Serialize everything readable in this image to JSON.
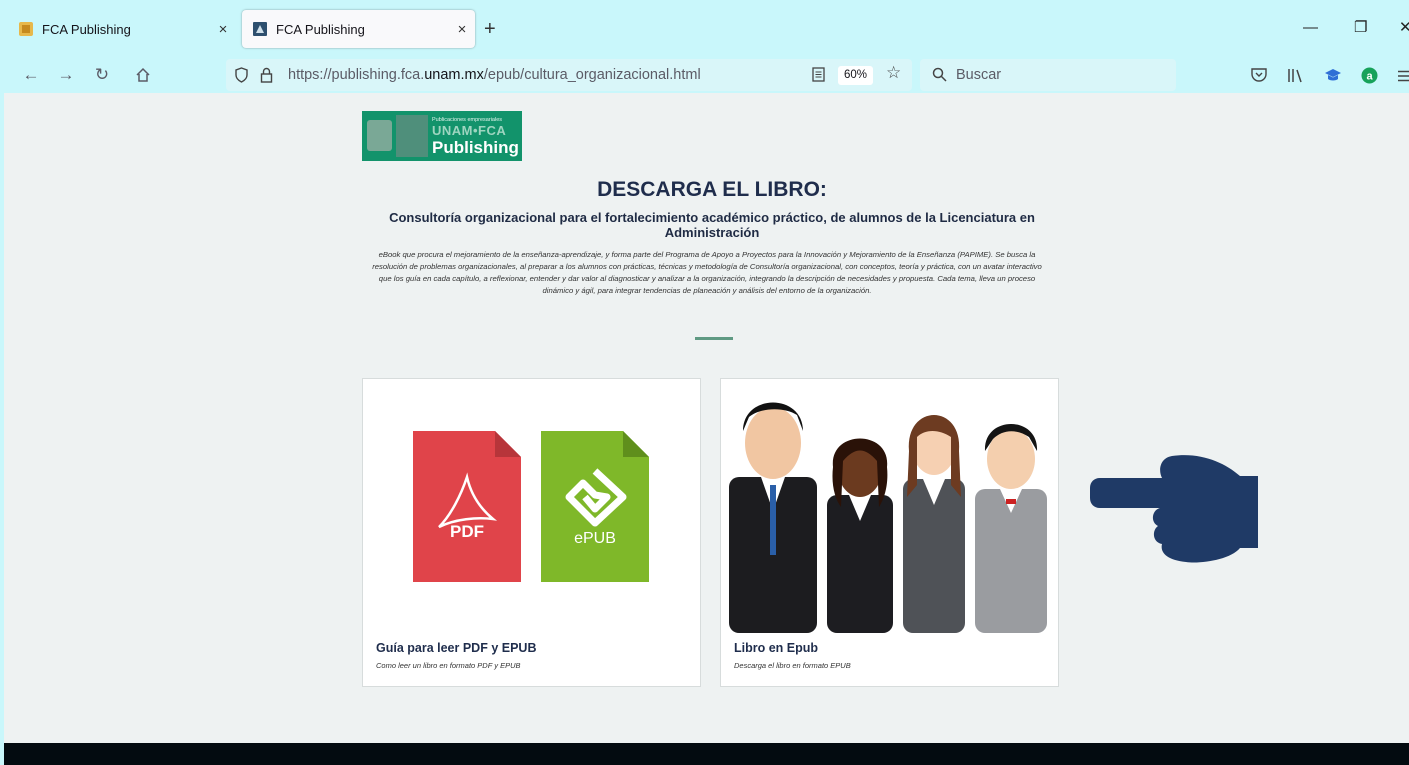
{
  "browser": {
    "tabs": [
      {
        "title": "FCA Publishing",
        "close": "×"
      },
      {
        "title": "FCA Publishing",
        "close": "×"
      }
    ],
    "new_tab": "+",
    "window_controls": {
      "minimize": "—",
      "restore": "❐",
      "close": "✕"
    },
    "url": {
      "prefix": "https://publishing.fca.",
      "domain": "unam.mx",
      "path": "/epub/cultura_organizacional.html"
    },
    "zoom": "60%",
    "search_placeholder": "Buscar",
    "icons": [
      "back-icon",
      "forward-icon",
      "reload-icon",
      "home-icon",
      "shield-icon",
      "lock-icon",
      "reader-view-icon",
      "bookmark-star-icon",
      "search-icon",
      "pocket-icon",
      "library-icon",
      "graduation-cap-icon",
      "a-extension-icon",
      "menu-icon"
    ]
  },
  "page": {
    "logo": {
      "small_text": "Publicaciones empresariales",
      "unam_text": "UNAM•FCA",
      "brand": "Publishing"
    },
    "heading": "DESCARGA EL LIBRO:",
    "subtitle": "Consultoría organizacional para el fortalecimiento académico práctico, de alumnos de la Licenciatura en Administración",
    "description": "eBook que procura el mejoramiento de la enseñanza-aprendizaje, y forma parte del Programa de Apoyo a Proyectos para la Innovación y Mejoramiento de la Enseñanza (PAPIME). Se busca la resolución de problemas organizacionales, al preparar a los alumnos con prácticas, técnicas y metodología de Consultoría organizacional, con conceptos, teoría y práctica, con un avatar interactivo que los guía en cada capítulo, a reflexionar, entender y dar valor al diagnosticar y analizar a la organización, integrando la descripción de necesidades y propuesta. Cada tema, lleva un proceso dinámico y ágil, para integrar tendencias de planeación y análisis del entorno de la organización.",
    "cards": [
      {
        "title": "Guía para leer PDF y EPUB",
        "subtitle": "Como leer un libro en formato PDF y EPUB",
        "pdf_label": "PDF",
        "epub_label": "ePUB"
      },
      {
        "title": "Libro en Epub",
        "subtitle": "Descarga el libro en formato EPUB"
      }
    ]
  },
  "colors": {
    "browser_bg": "#c9f7fb",
    "page_bg": "#eef2f2",
    "heading": "#1f2d4c",
    "pdf_red": "#e0444a",
    "epub_green": "#7fb829",
    "pointer_navy": "#1f3a66",
    "footer": "#030b10"
  }
}
